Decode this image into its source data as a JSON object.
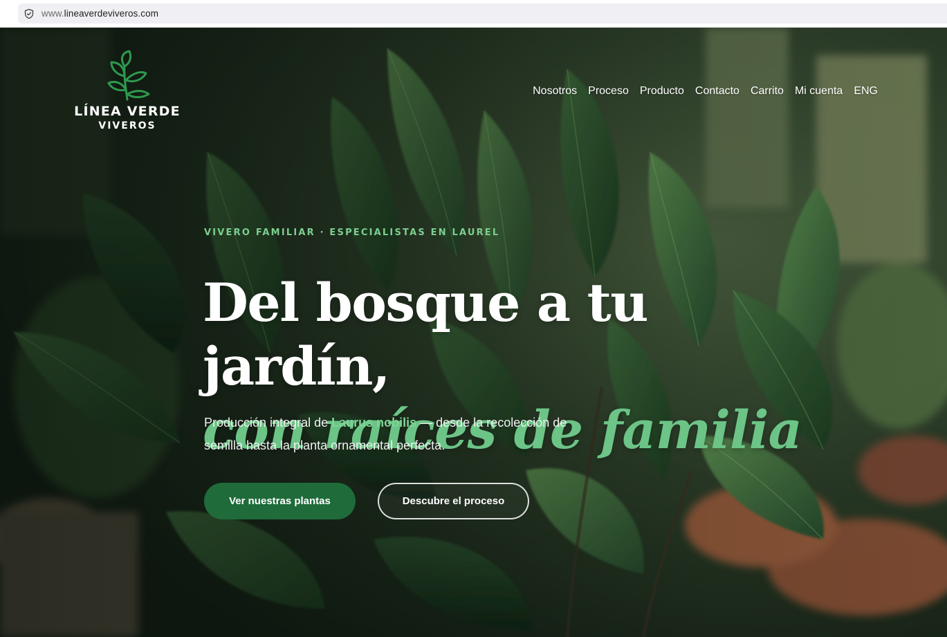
{
  "browser": {
    "url_prefix": "www.",
    "url_domain": "lineaverdeviveros.com"
  },
  "brand": {
    "name_line1": "LÍNEA VERDE",
    "name_line2": "VIVEROS",
    "icon": "leaf-sprig-icon",
    "color": "#2e9a4e"
  },
  "nav": {
    "items": [
      {
        "label": "Nosotros"
      },
      {
        "label": "Proceso"
      },
      {
        "label": "Producto"
      },
      {
        "label": "Contacto"
      },
      {
        "label": "Carrito"
      },
      {
        "label": "Mi cuenta"
      },
      {
        "label": "ENG"
      }
    ]
  },
  "hero": {
    "eyebrow": "VIVERO FAMILIAR · ESPECIALISTAS EN LAUREL",
    "headline_line1": "Del bosque a tu jardín,",
    "headline_line2": "con raíces de familia",
    "subtitle_part1": "Producción integral de ",
    "subtitle_highlight": "Laurus nobilis",
    "subtitle_part2": " — desde la recolección de semilla hasta la planta ornamental perfecta.",
    "primary_button": "Ver nuestras plantas",
    "secondary_button": "Descubre el proceso",
    "accent_color": "#6cc487",
    "button_color": "#1f6b3a"
  }
}
